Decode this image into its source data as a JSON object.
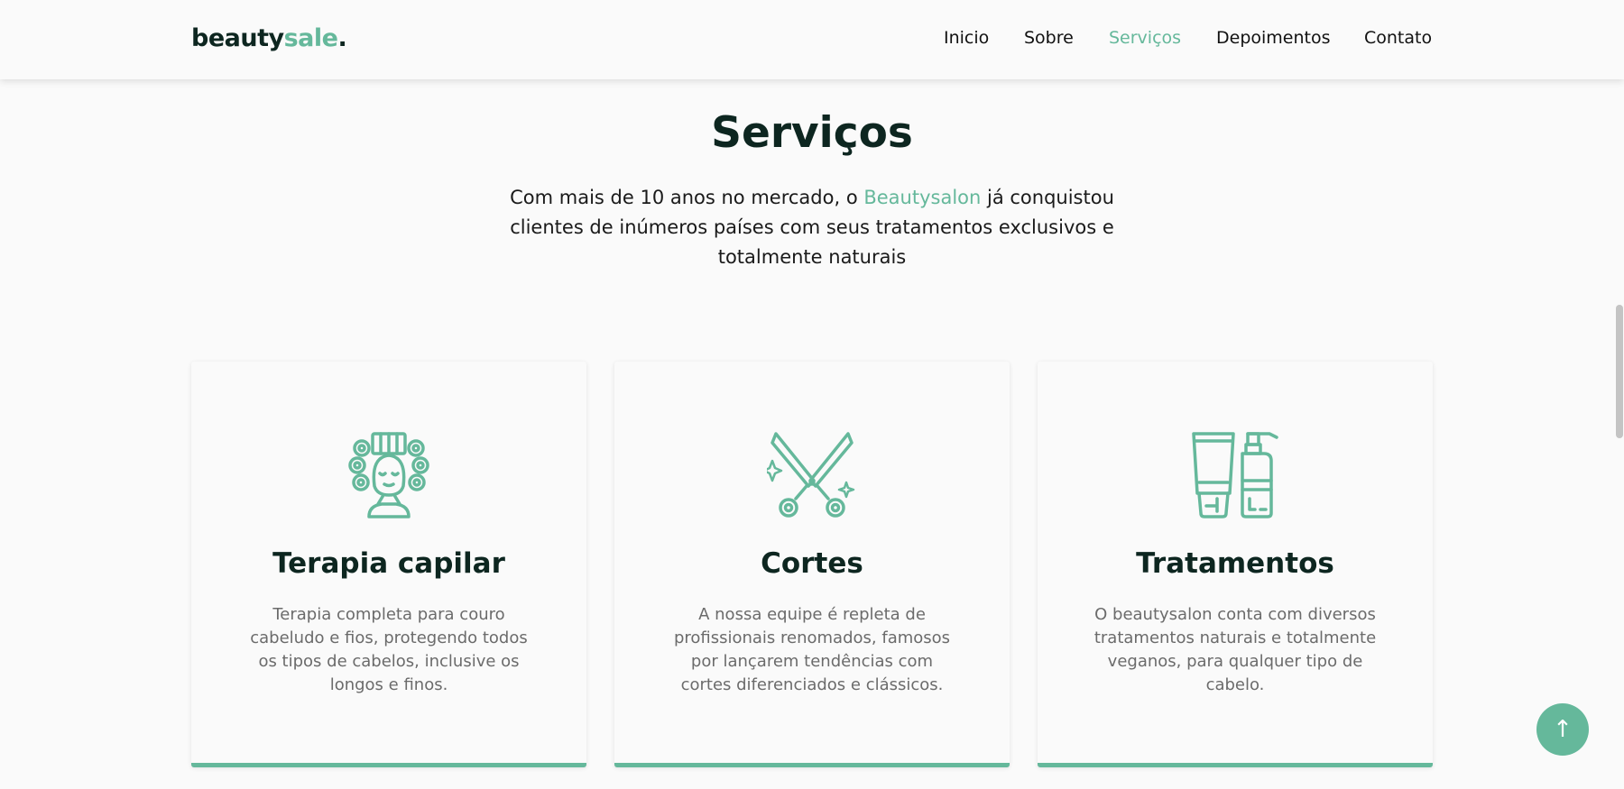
{
  "header": {
    "logo": {
      "main": "beauty",
      "accent": "sale",
      "dot": "."
    },
    "nav": [
      {
        "label": "Inicio",
        "active": false
      },
      {
        "label": "Sobre",
        "active": false
      },
      {
        "label": "Serviços",
        "active": true
      },
      {
        "label": "Depoimentos",
        "active": false
      },
      {
        "label": "Contato",
        "active": false
      }
    ]
  },
  "section": {
    "title": "Serviços",
    "description_before": "Com mais de 10 anos no mercado, o ",
    "description_brand": "Beautysalon",
    "description_after": " já conquistou clientes de inúmeros países com seus tratamentos exclusivos e totalmente naturais"
  },
  "cards": [
    {
      "icon": "hair-rollers-icon",
      "title": "Terapia capilar",
      "text": "Terapia completa para couro cabeludo e fios, protegendo todos os tipos de cabelos, inclusive os longos e finos."
    },
    {
      "icon": "scissors-icon",
      "title": "Cortes",
      "text": "A nossa equipe é repleta de profissionais renomados, famosos por lançarem tendências com cortes diferenciados e clássicos."
    },
    {
      "icon": "cosmetic-bottles-icon",
      "title": "Tratamentos",
      "text": "O beautysalon conta com diversos tratamentos naturais e totalmente veganos, para qualquer tipo de cabelo."
    }
  ],
  "back_to_top": {
    "icon": "arrow-up-icon",
    "glyph": "↑"
  },
  "colors": {
    "accent": "#65b89b",
    "title": "#0d2620",
    "background": "#fafafa",
    "body_text": "#6b6b6b"
  }
}
